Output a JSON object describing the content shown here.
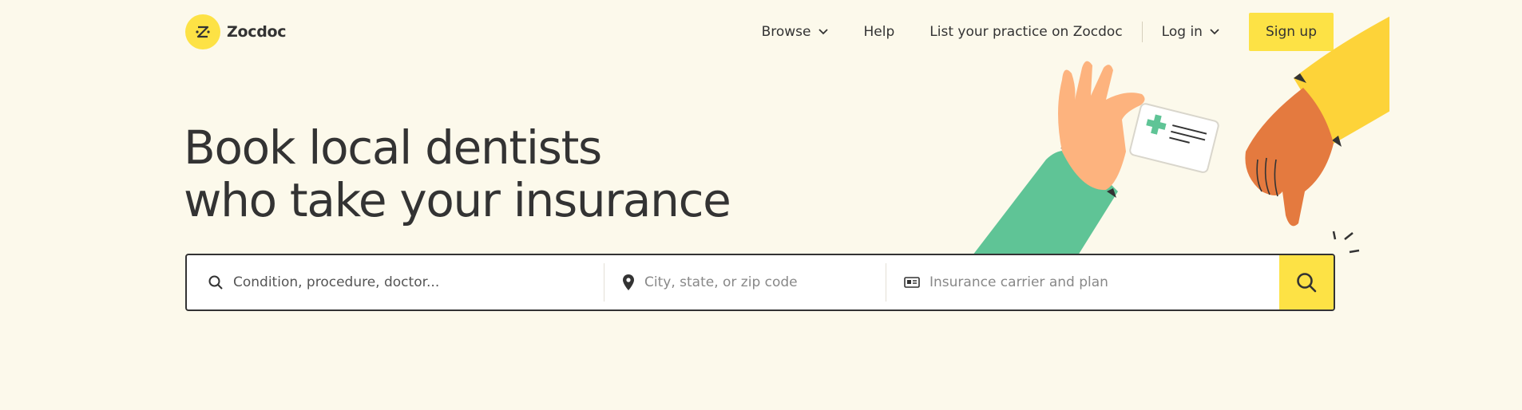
{
  "brand": {
    "name": "Zocdoc",
    "logo_color": "#fde245"
  },
  "nav": {
    "browse": "Browse",
    "help": "Help",
    "list_practice": "List your practice on Zocdoc",
    "login": "Log in",
    "signup": "Sign up"
  },
  "hero": {
    "line1": "Book local dentists",
    "line2": "who take your insurance"
  },
  "search": {
    "condition_placeholder": "Condition, procedure, doctor...",
    "location_placeholder": "City, state, or zip code",
    "insurance_placeholder": "Insurance carrier and plan"
  },
  "colors": {
    "background": "#fcf9eb",
    "accent": "#fde245",
    "text": "#333333"
  }
}
